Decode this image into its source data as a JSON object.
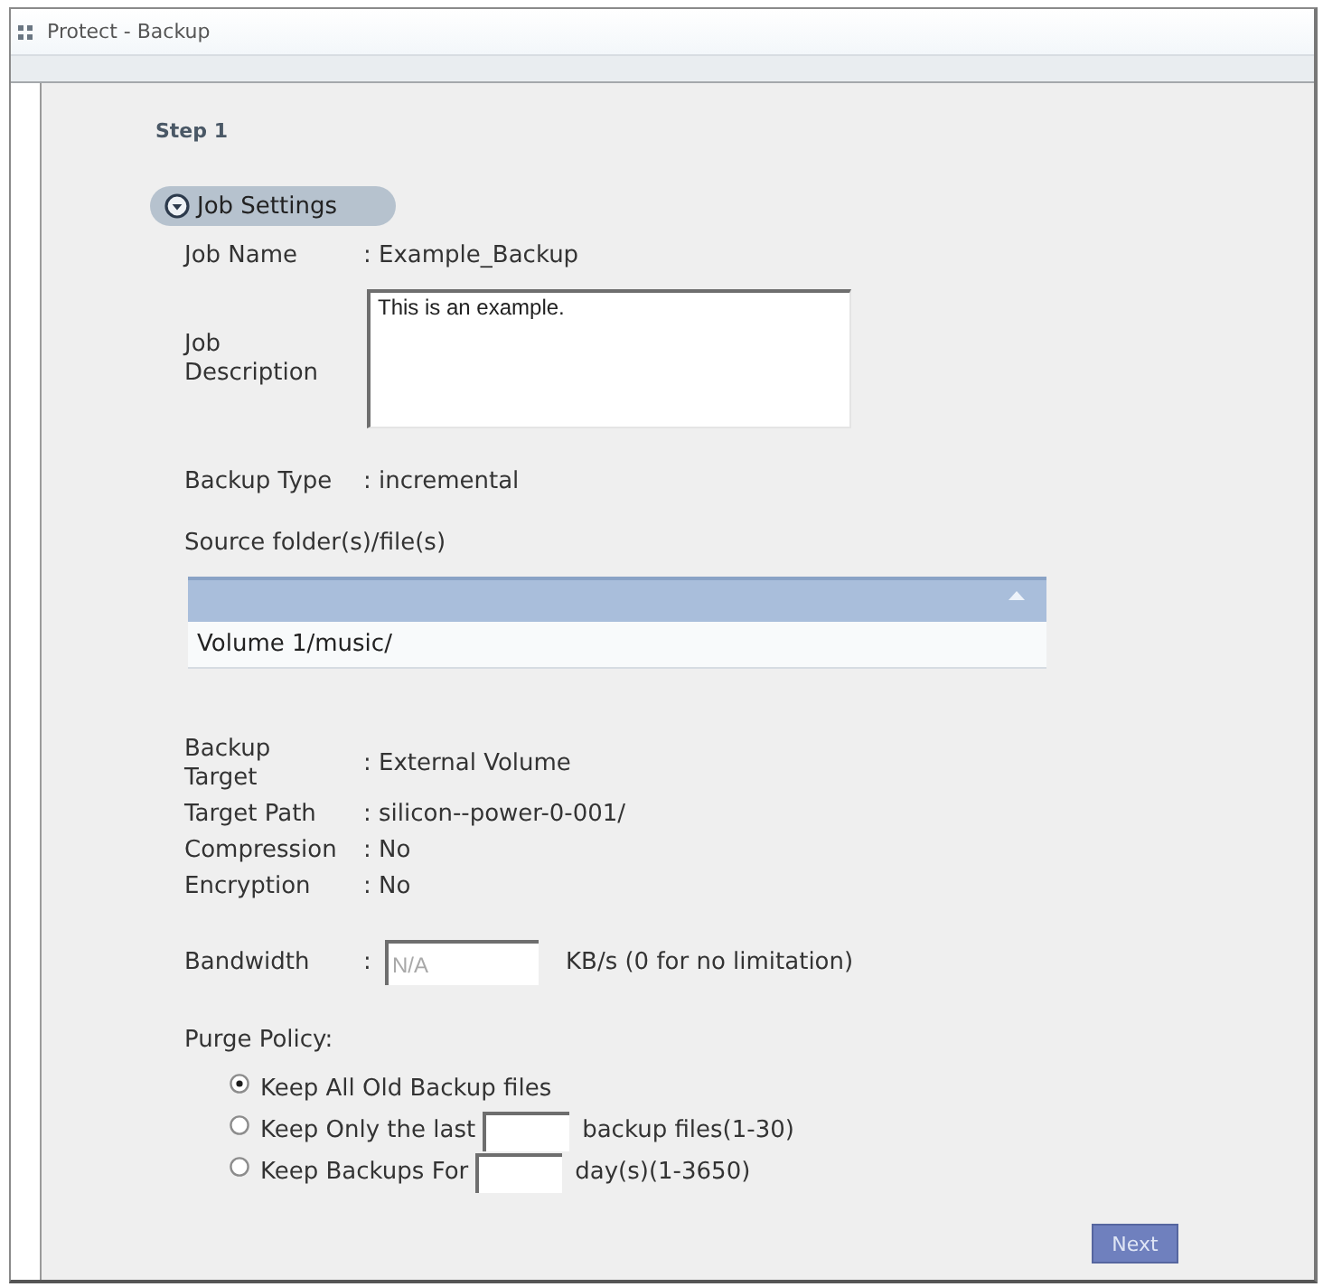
{
  "window": {
    "title": "Protect - Backup"
  },
  "step": "Step 1",
  "section": {
    "label": "Job Settings"
  },
  "job_fields": [
    {
      "kind": "text",
      "label": "Job Name",
      "value": ": Example_Backup"
    },
    {
      "kind": "textarea",
      "label": "Job Description",
      "value": "This is an example."
    },
    {
      "kind": "text",
      "label": "Backup Type",
      "value": ": incremental"
    }
  ],
  "source": {
    "label": "Source folder(s)/file(s)",
    "items": [
      "Volume 1/music/"
    ]
  },
  "target_fields": [
    {
      "label": "Backup Target",
      "value": ": External Volume"
    },
    {
      "label": "Target Path",
      "value": ": silicon--power-0-001/"
    },
    {
      "label": "Compression",
      "value": ": No"
    },
    {
      "label": "Encryption",
      "value": ": No"
    }
  ],
  "bandwidth": {
    "label": "Bandwidth",
    "separator": ":",
    "placeholder": "N/A",
    "unit": "KB/s (0 for no limitation)"
  },
  "purge_policy": {
    "label": "Purge Policy:",
    "options": [
      {
        "kind": "plain",
        "selected": true,
        "label": "Keep All Old Backup files"
      },
      {
        "kind": "field",
        "selected": false,
        "label": "Keep Only the last",
        "suffix": "backup files(1-30)"
      },
      {
        "kind": "field",
        "selected": false,
        "label": "Keep Backups For",
        "suffix": "day(s)(1-3650)"
      }
    ]
  },
  "buttons": [
    {
      "label": "Next"
    }
  ]
}
